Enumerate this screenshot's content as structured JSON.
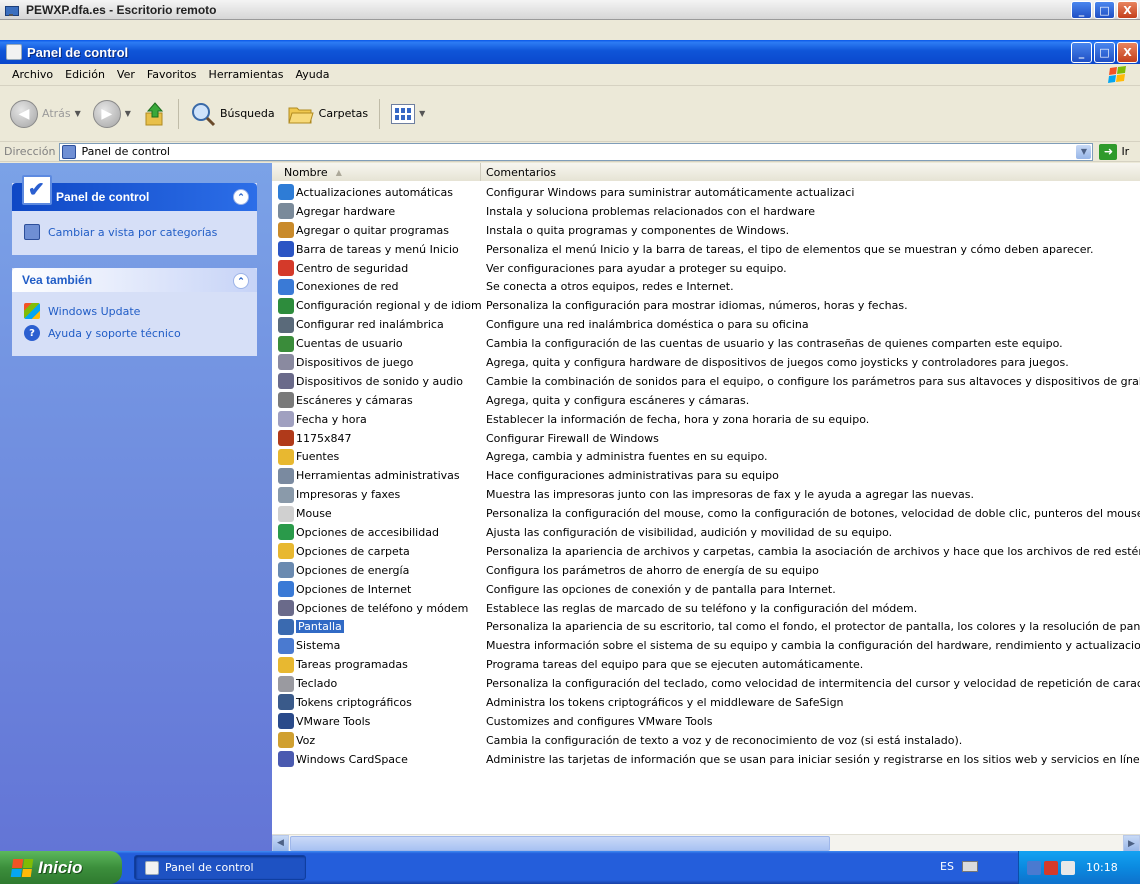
{
  "remote_window": {
    "title": "PEWXP.dfa.es - Escritorio remoto"
  },
  "window": {
    "title": "Panel de control"
  },
  "title_buttons": {
    "minimize": "_",
    "maximize": "□",
    "close": "X"
  },
  "menu": [
    "Archivo",
    "Edición",
    "Ver",
    "Favoritos",
    "Herramientas",
    "Ayuda"
  ],
  "toolbar": {
    "back": "Atrás",
    "search": "Búsqueda",
    "folders": "Carpetas"
  },
  "address": {
    "label": "Dirección",
    "value": "Panel de control",
    "go": "Ir"
  },
  "left_pane": {
    "main_box": {
      "title": "Panel de control",
      "link": "Cambiar a vista por categorías"
    },
    "see_also": {
      "title": "Vea también",
      "links": [
        "Windows Update",
        "Ayuda y soporte técnico"
      ]
    }
  },
  "list": {
    "columns": {
      "name": "Nombre",
      "comments": "Comentarios"
    },
    "items": [
      {
        "name": "Actualizaciones automáticas",
        "comment": "Configurar Windows para suministrar automáticamente actualizaci",
        "icon": "globe-icon",
        "color": "#2e7cd6"
      },
      {
        "name": "Agregar hardware",
        "comment": "Instala y soluciona problemas relacionados con el hardware",
        "icon": "hardware-icon",
        "color": "#7a8a9a"
      },
      {
        "name": "Agregar o quitar programas",
        "comment": "Instala o quita programas y componentes de Windows.",
        "icon": "programs-icon",
        "color": "#c98a2a"
      },
      {
        "name": "Barra de tareas y menú Inicio",
        "comment": "Personaliza el menú Inicio y la barra de tareas, el tipo de elementos que se muestran y cómo deben aparecer.",
        "icon": "taskbar-icon",
        "color": "#2b55c4"
      },
      {
        "name": "Centro de seguridad",
        "comment": "Ver configuraciones para ayudar a proteger su equipo.",
        "icon": "shield-icon",
        "color": "#d43a2a"
      },
      {
        "name": "Conexiones de red",
        "comment": "Se conecta a otros equipos, redes e Internet.",
        "icon": "network-icon",
        "color": "#3a7ad6"
      },
      {
        "name": "Configuración regional y de idioma",
        "comment": "Personaliza la configuración para mostrar idiomas, números, horas y fechas.",
        "icon": "globe-icon",
        "color": "#2d8c3c"
      },
      {
        "name": "Configurar red inalámbrica",
        "comment": "Configure una red inalámbrica doméstica o para su oficina",
        "icon": "wireless-icon",
        "color": "#5a6a7a"
      },
      {
        "name": "Cuentas de usuario",
        "comment": "Cambia la configuración de las cuentas de usuario y las contraseñas de quienes comparten este equipo.",
        "icon": "users-icon",
        "color": "#3a8c3a"
      },
      {
        "name": "Dispositivos de juego",
        "comment": "Agrega, quita y configura hardware de dispositivos de juegos como joysticks y controladores para juegos.",
        "icon": "gamepad-icon",
        "color": "#8a8aa0"
      },
      {
        "name": "Dispositivos de sonido y audio",
        "comment": "Cambie la combinación de sonidos para el  equipo, o configure los parámetros para sus altavoces y dispositivos de grabación.",
        "icon": "speaker-icon",
        "color": "#6a6a8a"
      },
      {
        "name": "Escáneres y cámaras",
        "comment": "Agrega, quita y configura escáneres y cámaras.",
        "icon": "camera-icon",
        "color": "#7a7a7a"
      },
      {
        "name": "Fecha y hora",
        "comment": "Establecer la información de fecha, hora y zona horaria de su equipo.",
        "icon": "clock-icon",
        "color": "#a0a0c0"
      },
      {
        "name": "1175x847",
        "comment": "Configurar Firewall de Windows",
        "icon": "firewall-icon",
        "color": "#b03a1a"
      },
      {
        "name": "Fuentes",
        "comment": "Agrega, cambia y administra fuentes en su equipo.",
        "icon": "fonts-folder-icon",
        "color": "#e8b830"
      },
      {
        "name": "Herramientas administrativas",
        "comment": "Hace configuraciones administrativas para su equipo",
        "icon": "admin-tools-icon",
        "color": "#7a8aa0"
      },
      {
        "name": "Impresoras y faxes",
        "comment": "Muestra las impresoras junto con las impresoras de fax y le ayuda a agregar las nuevas.",
        "icon": "printer-icon",
        "color": "#8a9aaa"
      },
      {
        "name": "Mouse",
        "comment": "Personaliza la configuración del mouse, como la configuración de botones, velocidad de doble clic, punteros del mouse y velocidad de movimiento.",
        "icon": "mouse-icon",
        "color": "#d0d0d0"
      },
      {
        "name": "Opciones de accesibilidad",
        "comment": "Ajusta las configuración de visibilidad, audición y movilidad de su equipo.",
        "icon": "accessibility-icon",
        "color": "#2a9a4a"
      },
      {
        "name": "Opciones de carpeta",
        "comment": "Personaliza la apariencia de archivos y carpetas, cambia la asociación de archivos y hace que los archivos de red estén disponibles sin conexión.",
        "icon": "folder-options-icon",
        "color": "#e8b830"
      },
      {
        "name": "Opciones de energía",
        "comment": "Configura los parámetros de ahorro de energía de su equipo",
        "icon": "power-icon",
        "color": "#6a8ab0"
      },
      {
        "name": "Opciones de Internet",
        "comment": "Configure las opciones de conexión y de pantalla para Internet.",
        "icon": "internet-icon",
        "color": "#3a7ad6"
      },
      {
        "name": "Opciones de teléfono y módem",
        "comment": "Establece las reglas de marcado de su teléfono y la configuración del módem.",
        "icon": "phone-icon",
        "color": "#6a6a8a"
      },
      {
        "name": "Pantalla",
        "comment": "Personaliza la apariencia de su escritorio, tal como el fondo, el protector de pantalla, los colores y la resolución de pantalla.",
        "icon": "display-icon",
        "color": "#3a6ab0"
      },
      {
        "name": "Sistema",
        "comment": "Muestra información sobre el sistema de su equipo y cambia la configuración del hardware, rendimiento y actualizaciones automáticas.",
        "icon": "system-icon",
        "color": "#4a7ad0"
      },
      {
        "name": "Tareas programadas",
        "comment": "Programa tareas del equipo para que se ejecuten automáticamente.",
        "icon": "scheduled-tasks-icon",
        "color": "#e8b830"
      },
      {
        "name": "Teclado",
        "comment": "Personaliza la configuración del teclado, como velocidad de intermitencia del cursor y velocidad de repetición de caracteres.",
        "icon": "keyboard-icon",
        "color": "#9a9aa0"
      },
      {
        "name": "Tokens criptográficos",
        "comment": "Administra los tokens criptográficos y el middleware de SafeSign",
        "icon": "token-icon",
        "color": "#3a5a8a"
      },
      {
        "name": "VMware Tools",
        "comment": "Customizes and configures VMware Tools",
        "icon": "vmware-icon",
        "color": "#2a4a8a"
      },
      {
        "name": "Voz",
        "comment": "Cambia la configuración de texto a voz y de reconocimiento de voz (si está instalado).",
        "icon": "speech-icon",
        "color": "#d0a030"
      },
      {
        "name": "Windows CardSpace",
        "comment": "Administre las tarjetas de información que se usan para iniciar sesión y registrarse en los sitios web y servicios en línea.",
        "icon": "cardspace-icon",
        "color": "#4a5ab0"
      }
    ],
    "selected_index": 23
  },
  "taskbar": {
    "start": "Inicio",
    "task": "Panel de control",
    "lang": "ES",
    "clock": "10:18"
  },
  "colors": {
    "titlebar": "#0a47cc",
    "task_pane": "#7ba2e7",
    "link": "#215dc6",
    "selection": "#316ac5"
  }
}
